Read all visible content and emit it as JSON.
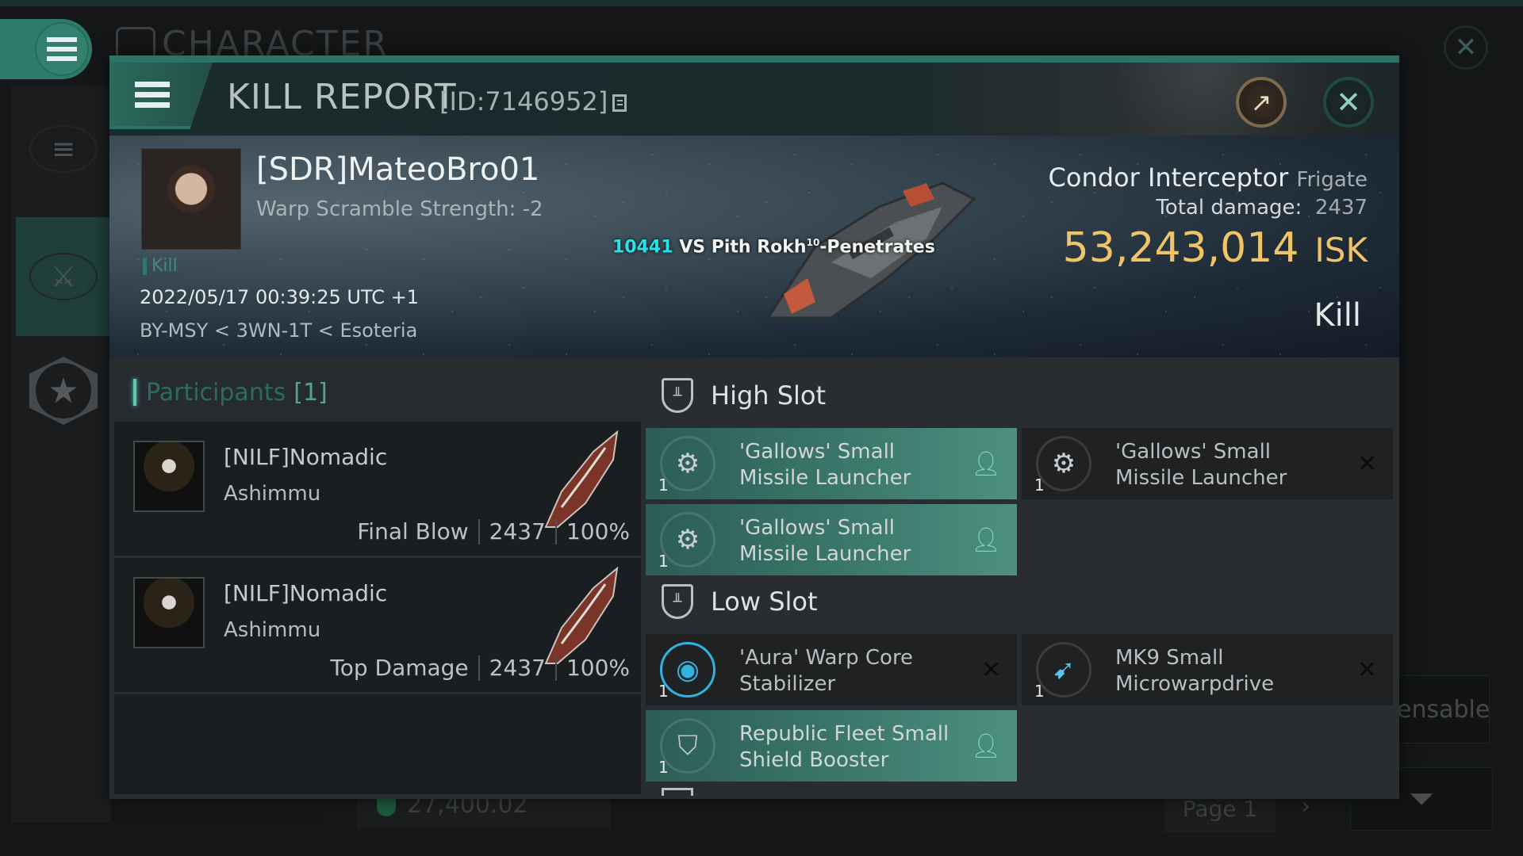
{
  "background": {
    "title": "CHARACTER",
    "wallet_value": "27,400.02",
    "page_label": "Page 1",
    "dispensable_label": "ensable",
    "sidebar_icons": [
      "menu-icon",
      "crossed-swords-icon",
      "star-icon"
    ]
  },
  "window": {
    "title": "KILL REPORT",
    "id_label": "[ID:7146952]",
    "external_icon": "↗",
    "close_icon": "✕"
  },
  "victim": {
    "name": "[SDR]MateoBro01",
    "warp_scramble": "Warp Scramble Strength: -2",
    "kill_tag": "Kill",
    "datetime": "2022/05/17 00:39:25 UTC +1",
    "location": "BY-MSY < 3WN-1T < Esoteria",
    "ship_name": "Condor Interceptor",
    "ship_class": "Frigate",
    "total_damage_label": "Total damage:",
    "total_damage_value": "2437",
    "isk_value": "53,243,014",
    "isk_unit": "ISK",
    "result": "Kill",
    "damage_event": {
      "number": "10441",
      "text": " VS Pith Rokh",
      "sup": "10",
      "suffix": "-Penetrates"
    }
  },
  "participants": {
    "label": "Participants",
    "count": "[1]",
    "rows": [
      {
        "name": "[NILF]Nomadic",
        "ship": "Ashimmu",
        "role": "Final Blow",
        "damage": "2437",
        "percent": "100%"
      },
      {
        "name": "[NILF]Nomadic",
        "ship": "Ashimmu",
        "role": "Top Damage",
        "damage": "2437",
        "percent": "100%"
      }
    ]
  },
  "fittings": {
    "high_slot": {
      "label": "High Slot",
      "modules": [
        {
          "name": "'Gallows' Small Missile Launcher",
          "qty": "1",
          "status": "dropped"
        },
        {
          "name": "'Gallows' Small Missile Launcher",
          "qty": "1",
          "status": "destroyed"
        },
        {
          "name": "'Gallows' Small Missile Launcher",
          "qty": "1",
          "status": "dropped"
        }
      ]
    },
    "low_slot": {
      "label": "Low Slot",
      "modules": [
        {
          "name": "'Aura' Warp Core Stabilizer",
          "qty": "1",
          "status": "destroyed"
        },
        {
          "name": "MK9 Small Microwarpdrive",
          "qty": "1",
          "status": "destroyed"
        },
        {
          "name": "Republic Fleet Small Shield Booster",
          "qty": "1",
          "status": "dropped"
        }
      ]
    },
    "status_icons": {
      "dropped": "pilot-icon",
      "destroyed": "x-icon"
    }
  },
  "colors": {
    "accent": "#2e7266",
    "isk": "#efc468",
    "damage_number": "#25e1e8",
    "dropped_row": "#3d7a6d"
  }
}
